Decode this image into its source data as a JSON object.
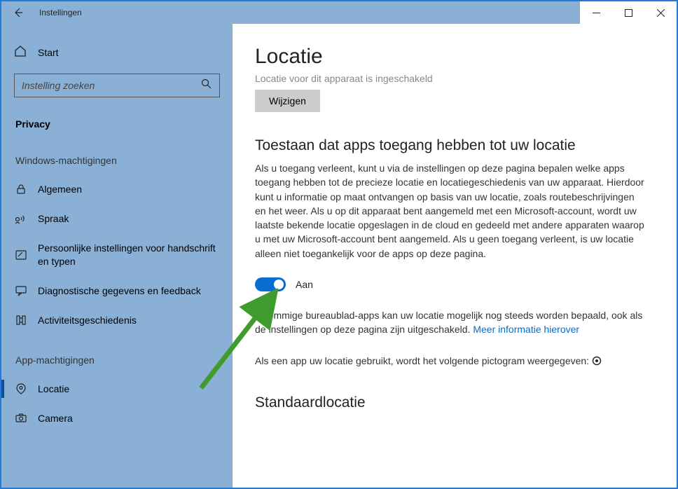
{
  "titlebar": {
    "app_name": "Instellingen"
  },
  "sidebar": {
    "start_label": "Start",
    "search_placeholder": "Instelling zoeken",
    "current_section": "Privacy",
    "group1_header": "Windows-machtigingen",
    "group1_items": [
      {
        "label": "Algemeen"
      },
      {
        "label": "Spraak"
      },
      {
        "label": "Persoonlijke instellingen voor handschrift en typen"
      },
      {
        "label": "Diagnostische gegevens en feedback"
      },
      {
        "label": "Activiteitsgeschiedenis"
      }
    ],
    "group2_header": "App-machtigingen",
    "group2_items": [
      {
        "label": "Locatie"
      },
      {
        "label": "Camera"
      }
    ]
  },
  "content": {
    "title": "Locatie",
    "status_line": "Locatie voor dit apparaat is ingeschakeld",
    "change_button": "Wijzigen",
    "allow_heading": "Toestaan dat apps toegang hebben tot uw locatie",
    "allow_body": "Als u toegang verleent, kunt u via de instellingen op deze pagina bepalen welke apps toegang hebben tot de precieze locatie en locatiegeschiedenis van uw apparaat. Hierdoor kunt u informatie op maat ontvangen op basis van uw locatie, zoals routebeschrijvingen en het weer. Als u op dit apparaat bent aangemeld met een Microsoft-account, wordt uw laatste bekende locatie opgeslagen in de cloud en gedeeld met andere apparaten waarop u met uw Microsoft-account bent aangemeld. Als u geen toegang verleent, is uw locatie alleen niet toegankelijk voor de apps op deze pagina.",
    "toggle_label": "Aan",
    "desktop_note_prefix": "n sommige bureaublad-apps kan uw locatie mogelijk nog steeds worden bepaald, ook als de instellingen op deze pagina zijn uitgeschakeld. ",
    "desktop_note_link": "Meer informatie hierover",
    "icon_note": "Als een app uw locatie gebruikt, wordt het volgende pictogram weergegeven:",
    "default_heading": "Standaardlocatie"
  }
}
